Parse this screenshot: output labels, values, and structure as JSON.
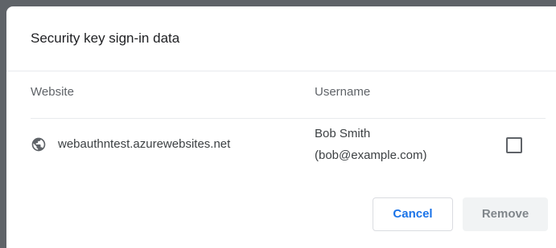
{
  "dialog": {
    "title": "Security key sign-in data",
    "columns": {
      "website": "Website",
      "username": "Username"
    },
    "rows": [
      {
        "icon": "globe-icon",
        "website": "webauthntest.azurewebsites.net",
        "username_name": "Bob Smith",
        "username_email": "(bob@example.com)",
        "checked": false
      }
    ],
    "buttons": {
      "cancel": "Cancel",
      "remove": "Remove"
    }
  },
  "colors": {
    "accent": "#1a73e8",
    "text": "#3c4043",
    "secondary_text": "#5f6368",
    "disabled_button_bg": "#f1f3f4"
  }
}
